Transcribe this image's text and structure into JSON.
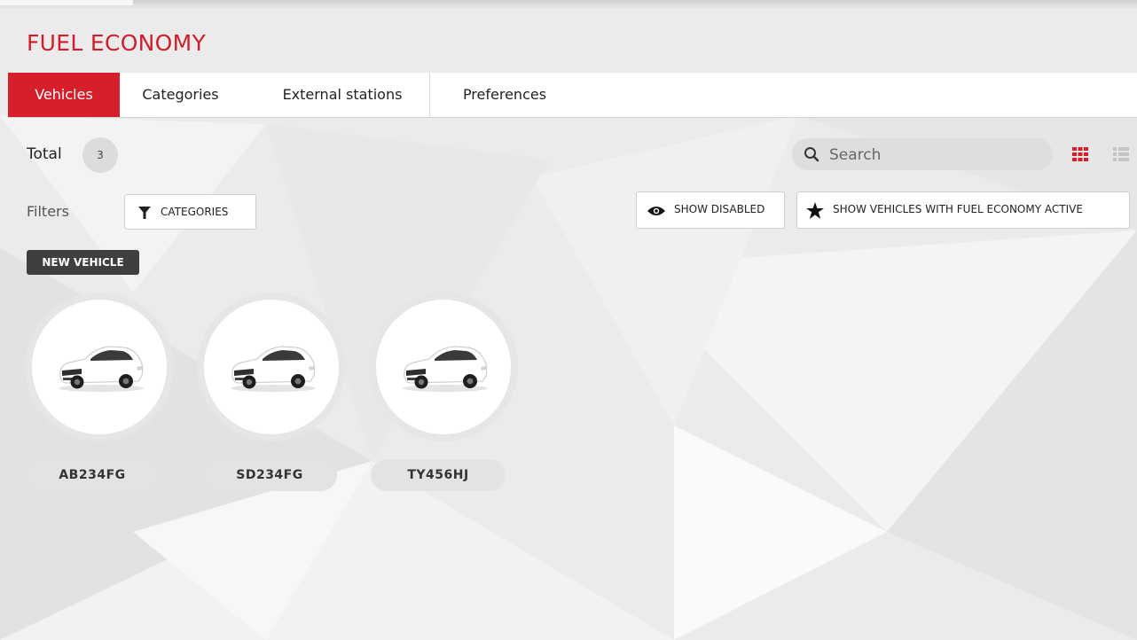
{
  "app": {
    "title": "FUEL ECONOMY"
  },
  "tabs": [
    {
      "label": "Vehicles",
      "active": true
    },
    {
      "label": "Categories",
      "active": false
    },
    {
      "label": "External stations",
      "active": false
    },
    {
      "label": "Preferences",
      "active": false
    }
  ],
  "summary": {
    "total_label": "Total",
    "total_count": "3"
  },
  "search": {
    "placeholder": "Search",
    "icon": "search-icon"
  },
  "view_toggle": {
    "grid_icon": "grid-view-icon",
    "list_icon": "list-view-icon",
    "active": "grid"
  },
  "filters": {
    "label": "Filters",
    "categories_button": "CATEGORIES",
    "show_disabled_button": "SHOW DISABLED",
    "show_active_button": "SHOW VEHICLES WITH FUEL ECONOMY ACTIVE"
  },
  "actions": {
    "new_vehicle": "NEW VEHICLE"
  },
  "vehicles": [
    {
      "plate": "AB234FG",
      "icon": "car-icon"
    },
    {
      "plate": "SD234FG",
      "icon": "car-icon"
    },
    {
      "plate": "TY456HJ",
      "icon": "car-icon"
    }
  ],
  "colors": {
    "accent": "#d61f2b",
    "title": "#cf1f2b",
    "badge_dark": "#3f3f3f"
  }
}
